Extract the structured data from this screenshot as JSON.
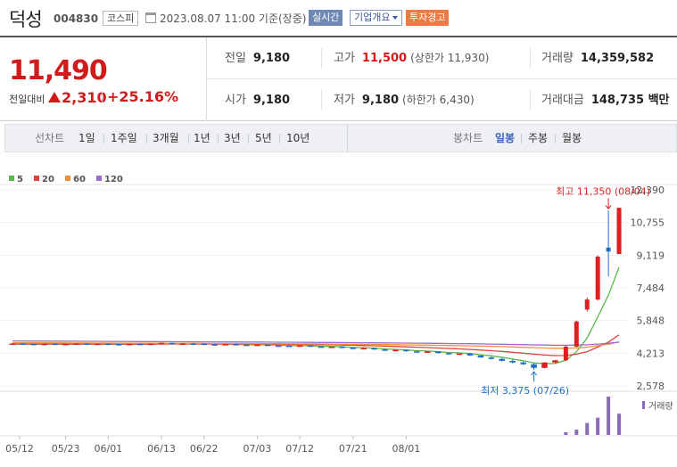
{
  "header": {
    "name": "덕성",
    "code": "004830",
    "market": "코스피",
    "date": "2023.08.07 11:00 기준(장중)",
    "realtime_label": "실시간",
    "overview_label": "기업개요",
    "warning_label": "투자경고"
  },
  "price": {
    "current": "11,490",
    "change_label": "전일대비",
    "change": "2,310",
    "change_pct": "+25.16%"
  },
  "stats": {
    "prev_label": "전일",
    "prev": "9,180",
    "high_label": "고가",
    "high": "11,500",
    "upper_limit": "(상한가 11,930)",
    "volume_label": "거래량",
    "volume": "14,359,582",
    "open_label": "시가",
    "open": "9,180",
    "low_label": "저가",
    "low": "9,180",
    "lower_limit": "(하한가 6,430)",
    "amount_label": "거래대금",
    "amount": "148,735 백만"
  },
  "period_bar": {
    "line_label": "선차트",
    "line_options": [
      "1일",
      "1주일",
      "3개월",
      "1년",
      "3년",
      "5년",
      "10년"
    ],
    "candle_label": "봉차트",
    "candle_options": [
      "일봉",
      "주봉",
      "월봉"
    ],
    "active_candle": "일봉"
  },
  "colors": {
    "up": "#e02020",
    "down": "#1f6fc8",
    "ma5": "#58b94a",
    "ma20": "#e0433c",
    "ma60": "#f0913a",
    "ma120": "#9a6ac9",
    "volume": "#8a6cb6"
  },
  "chart_data": {
    "type": "candlestick",
    "legend": [
      "5",
      "20",
      "60",
      "120"
    ],
    "y_ticks": [
      "12,390",
      "10,755",
      "9,119",
      "7,484",
      "5,848",
      "4,213",
      "2,578"
    ],
    "ylim": [
      2578,
      12390
    ],
    "x_labels": [
      "05/12",
      "05/23",
      "06/01",
      "06/13",
      "06/22",
      "07/03",
      "07/12",
      "07/21",
      "08/01"
    ],
    "high_annotation": "최고 11,350 (08/04)",
    "low_annotation": "최저 3,375 (07/26)",
    "volume_label": "거래량",
    "candles": [
      [
        4680,
        4720,
        4630,
        4700
      ],
      [
        4700,
        4740,
        4650,
        4680
      ],
      [
        4680,
        4700,
        4600,
        4620
      ],
      [
        4620,
        4700,
        4600,
        4690
      ],
      [
        4690,
        4720,
        4640,
        4650
      ],
      [
        4650,
        4700,
        4620,
        4680
      ],
      [
        4680,
        4730,
        4650,
        4700
      ],
      [
        4700,
        4720,
        4640,
        4660
      ],
      [
        4660,
        4710,
        4630,
        4690
      ],
      [
        4690,
        4720,
        4650,
        4670
      ],
      [
        4670,
        4700,
        4600,
        4630
      ],
      [
        4630,
        4690,
        4610,
        4680
      ],
      [
        4680,
        4720,
        4650,
        4660
      ],
      [
        4660,
        4700,
        4620,
        4690
      ],
      [
        4690,
        4760,
        4670,
        4730
      ],
      [
        4730,
        4750,
        4660,
        4680
      ],
      [
        4680,
        4720,
        4650,
        4700
      ],
      [
        4700,
        4740,
        4670,
        4690
      ],
      [
        4690,
        4720,
        4640,
        4660
      ],
      [
        4660,
        4700,
        4610,
        4640
      ],
      [
        4640,
        4690,
        4610,
        4670
      ],
      [
        4670,
        4700,
        4620,
        4640
      ],
      [
        4640,
        4680,
        4590,
        4610
      ],
      [
        4610,
        4660,
        4580,
        4640
      ],
      [
        4640,
        4670,
        4580,
        4600
      ],
      [
        4600,
        4640,
        4560,
        4590
      ],
      [
        4590,
        4630,
        4540,
        4560
      ],
      [
        4560,
        4620,
        4540,
        4600
      ],
      [
        4600,
        4630,
        4530,
        4550
      ],
      [
        4550,
        4580,
        4490,
        4510
      ],
      [
        4510,
        4560,
        4480,
        4540
      ],
      [
        4540,
        4570,
        4470,
        4490
      ],
      [
        4490,
        4520,
        4420,
        4440
      ],
      [
        4440,
        4500,
        4410,
        4470
      ],
      [
        4470,
        4490,
        4380,
        4400
      ],
      [
        4400,
        4440,
        4330,
        4350
      ],
      [
        4350,
        4400,
        4310,
        4380
      ],
      [
        4380,
        4400,
        4290,
        4310
      ],
      [
        4310,
        4350,
        4240,
        4260
      ],
      [
        4260,
        4320,
        4230,
        4300
      ],
      [
        4300,
        4320,
        4200,
        4220
      ],
      [
        4220,
        4260,
        4150,
        4170
      ],
      [
        4170,
        4220,
        4120,
        4200
      ],
      [
        4200,
        4220,
        4080,
        4100
      ],
      [
        4100,
        4130,
        3980,
        4000
      ],
      [
        4000,
        4050,
        3900,
        3930
      ],
      [
        3930,
        3980,
        3800,
        3830
      ],
      [
        3830,
        3900,
        3700,
        3750
      ],
      [
        3750,
        3800,
        3620,
        3660
      ],
      [
        3660,
        3720,
        3375,
        3480
      ],
      [
        3480,
        3780,
        3450,
        3750
      ],
      [
        3750,
        3880,
        3700,
        3860
      ],
      [
        3860,
        4600,
        3840,
        4540
      ],
      [
        4540,
        5850,
        4500,
        5800
      ],
      [
        6400,
        7000,
        6300,
        6900
      ],
      [
        6900,
        9100,
        6850,
        9050
      ],
      [
        9500,
        11350,
        8050,
        9300
      ],
      [
        9180,
        11500,
        9180,
        11490
      ]
    ],
    "volume": [
      0,
      0,
      0,
      0,
      0,
      0,
      0,
      0,
      0,
      0,
      0,
      0,
      0,
      0,
      0,
      0,
      0,
      0,
      0,
      0,
      0,
      0,
      0,
      0,
      0,
      0,
      0,
      0,
      0,
      0,
      0,
      0,
      0,
      0,
      0,
      0,
      0,
      0,
      0,
      0,
      0,
      0,
      0,
      0,
      0,
      0,
      0,
      0,
      0,
      0,
      0,
      0,
      1.0,
      2.0,
      4.5,
      6.5,
      14.4,
      8.0
    ]
  }
}
